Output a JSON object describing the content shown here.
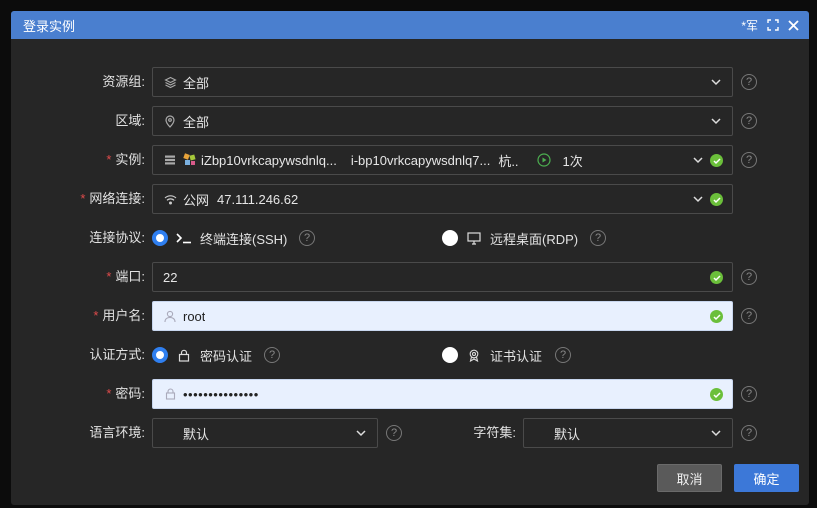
{
  "dialog": {
    "title": "登录实例",
    "pin_label": "*军",
    "fullscreen_icon": "fullscreen-icon",
    "close_icon": "close-icon"
  },
  "form": {
    "resource_group": {
      "label": "资源组:",
      "value": "全部",
      "icon": "layers-icon"
    },
    "region": {
      "label": "区域:",
      "value": "全部",
      "icon": "location-pin-icon"
    },
    "instance": {
      "required": "*",
      "label": "实例:",
      "instance_id": "iZbp10vrkcapywsdnlq...",
      "instance_name": "i-bp10vrkcapywsdnlq7...",
      "region": "杭..",
      "count": "1次"
    },
    "network": {
      "required": "*",
      "label": "网络连接:",
      "type": "公网",
      "ip": "47.111.246.62"
    },
    "protocol": {
      "label": "连接协议:",
      "option_ssh": "终端连接(SSH)",
      "option_rdp": "远程桌面(RDP)",
      "selected": "ssh"
    },
    "port": {
      "required": "*",
      "label": "端口:",
      "value": "22"
    },
    "username": {
      "required": "*",
      "label": "用户名:",
      "value": "root"
    },
    "auth": {
      "label": "认证方式:",
      "option_password": "密码认证",
      "option_cert": "证书认证",
      "selected": "password"
    },
    "password": {
      "required": "*",
      "label": "密码:",
      "value": "•••••••••••••••"
    },
    "locale": {
      "label": "语言环境:",
      "value": "默认"
    },
    "charset": {
      "label": "字符集:",
      "value": "默认"
    }
  },
  "buttons": {
    "cancel": "取消",
    "confirm": "确定"
  },
  "help_glyph": "?",
  "colors": {
    "titlebar": "#4a7fcf",
    "primary": "#3c78d8",
    "required": "#e04b4b",
    "success": "#6bbf3a",
    "radio": "#2f7ff0"
  }
}
